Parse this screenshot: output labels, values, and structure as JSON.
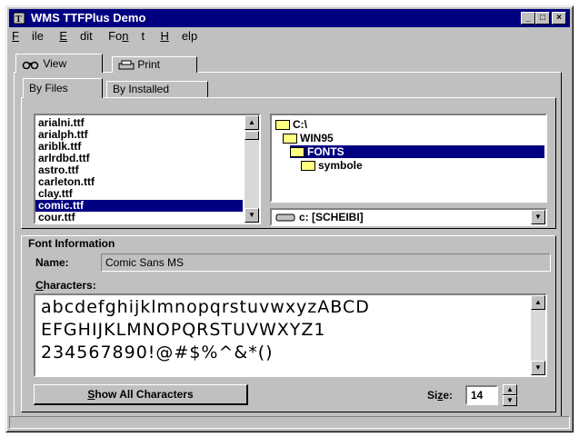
{
  "window": {
    "title": "WMS TTFPlus Demo"
  },
  "menu": [
    "File",
    "Edit",
    "Font",
    "Help"
  ],
  "top_tabs": {
    "view": "View",
    "print": "Print"
  },
  "sub_tabs": {
    "by_files": "By Files",
    "by_installed": "By Installed"
  },
  "file_list": {
    "items": [
      "arialni.ttf",
      "arialph.ttf",
      "ariblk.ttf",
      "arlrdbd.ttf",
      "astro.ttf",
      "carleton.ttf",
      "clay.ttf",
      "comic.ttf",
      "cour.ttf"
    ],
    "selected_index": 7
  },
  "dir_tree": {
    "items": [
      {
        "label": "C:\\"
      },
      {
        "label": "WIN95"
      },
      {
        "label": "FONTS",
        "selected": true
      },
      {
        "label": "symbole"
      }
    ]
  },
  "drive_select": {
    "value": "c: [SCHEIBI]"
  },
  "font_info": {
    "heading": "Font Information",
    "name_label": "Name:",
    "name_value": "Comic Sans MS",
    "characters_label": "Characters:",
    "characters_lines": [
      "abcdefghijklmnopqrstuvwxyzABCD",
      "EFGHIJKLMNOPQRSTUVWXYZ1",
      "234567890!@#$%^&*()"
    ]
  },
  "show_all_button": "Show All Characters",
  "size": {
    "label": "Size:",
    "value": "14"
  },
  "colors": {
    "titlebar": "#000080",
    "face": "#c0c0c0",
    "selection": "#000080"
  }
}
